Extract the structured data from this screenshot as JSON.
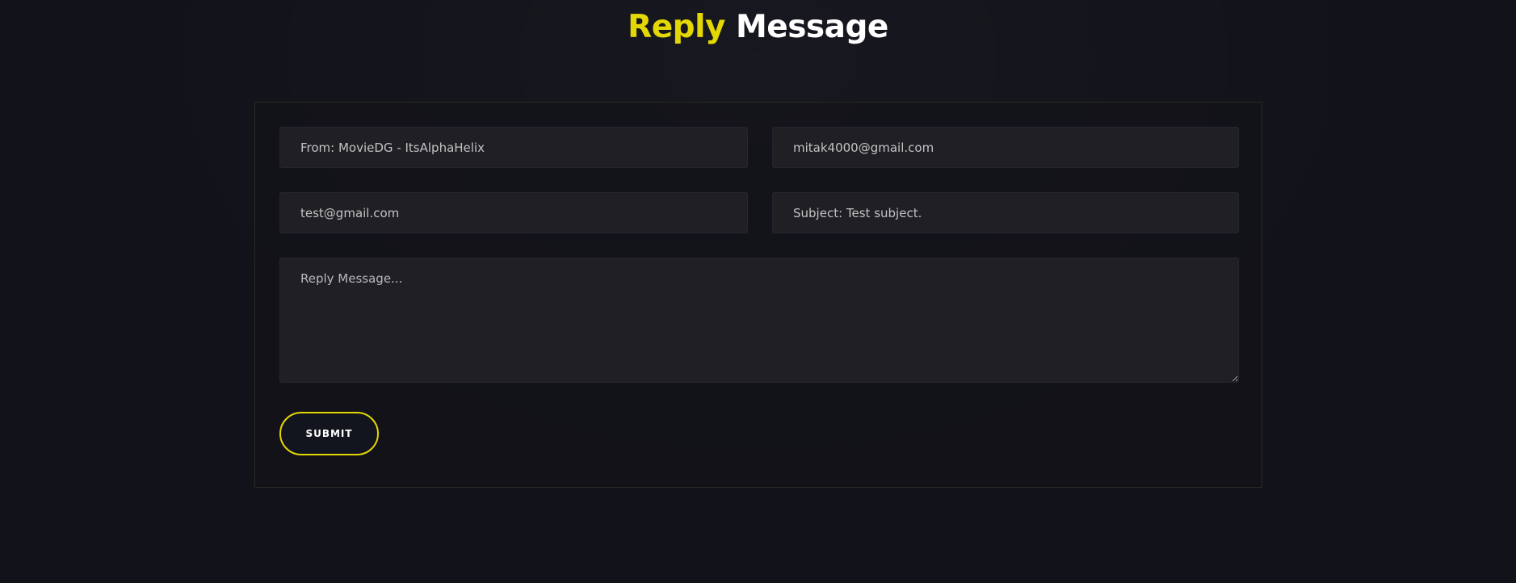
{
  "page": {
    "title_accent": "Reply",
    "title_main": "Message"
  },
  "form": {
    "from_value": "From: MovieDG - ItsAlphaHelix",
    "to_value": "mitak4000@gmail.com",
    "reply_to_value": "test@gmail.com",
    "subject_value": "Subject: Test subject.",
    "message_placeholder": "Reply Message...",
    "submit_label": "SUBMIT"
  },
  "colors": {
    "background": "#12121a",
    "accent": "#e4d804",
    "field_background": "#1f1f24",
    "text": "#ffffff"
  }
}
